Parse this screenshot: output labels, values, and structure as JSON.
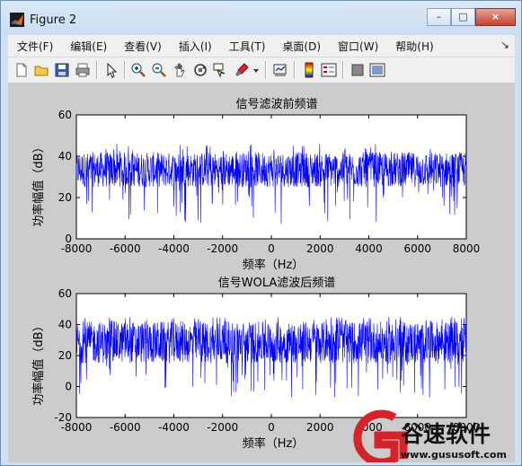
{
  "window": {
    "title": "Figure 2"
  },
  "window_controls": {
    "minimize": "–",
    "maximize": "□",
    "close": "×"
  },
  "menubar": {
    "items": [
      "文件(F)",
      "编辑(E)",
      "查看(V)",
      "插入(I)",
      "工具(T)",
      "桌面(D)",
      "窗口(W)",
      "帮助(H)"
    ],
    "overflow": "↘"
  },
  "toolbar": {
    "icons": [
      "new-figure-icon",
      "open-file-icon",
      "save-icon",
      "print-icon",
      "pointer-icon",
      "zoom-in-icon",
      "zoom-out-icon",
      "pan-icon",
      "rotate-3d-icon",
      "data-cursor-icon",
      "brush-icon",
      "brush-dropdown-icon",
      "link-plot-icon",
      "colorbar-icon",
      "legend-icon",
      "hide-plot-tools-icon",
      "show-plot-tools-icon"
    ]
  },
  "chart_data": [
    {
      "type": "line",
      "title": "信号滤波前频谱",
      "xlabel": "频率（Hz）",
      "ylabel": "功率幅值（dB）",
      "xlim": [
        -8000,
        8000
      ],
      "ylim": [
        0,
        60
      ],
      "xticks": [
        "-8000",
        "-6000",
        "-4000",
        "-2000",
        "0",
        "2000",
        "4000",
        "6000",
        "8000"
      ],
      "yticks": [
        "0",
        "20",
        "40",
        "60"
      ],
      "series": [
        {
          "color": "#0000ff",
          "band_low": 25,
          "band_high": 42,
          "min_dip": 7,
          "max_peak": 46
        }
      ]
    },
    {
      "type": "line",
      "title": "信号WOLA滤波后频谱",
      "xlabel": "频率（Hz）",
      "ylabel": "功率幅值（dB）",
      "xlim": [
        -8000,
        8000
      ],
      "ylim": [
        -20,
        60
      ],
      "xticks": [
        "-8000",
        "-6000",
        "-4000",
        "-2000",
        "0",
        "2000",
        "4000",
        "6000",
        "8000"
      ],
      "yticks": [
        "-20",
        "0",
        "20",
        "40",
        "60"
      ],
      "series": [
        {
          "color": "#0000ff",
          "band_low": 15,
          "band_high": 42,
          "min_dip": -7,
          "max_peak": 45
        }
      ]
    }
  ],
  "watermark": {
    "brand": "谷速软件",
    "url": "www.gususoft.com"
  }
}
